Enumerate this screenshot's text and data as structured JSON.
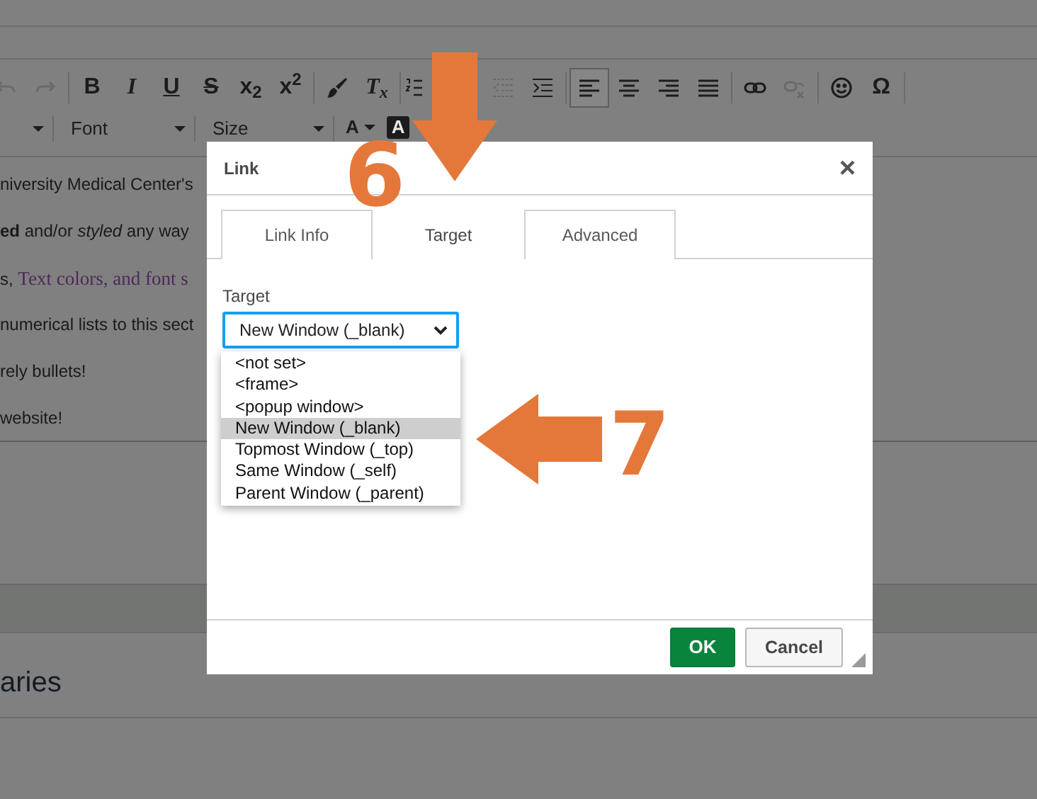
{
  "editor": {
    "toolbar": [
      {
        "kind": "undo",
        "disabled": true,
        "selected": false
      },
      {
        "kind": "redo",
        "disabled": true,
        "selected": false
      },
      {
        "kind": "separator"
      },
      {
        "kind": "bold",
        "label": "B",
        "disabled": false,
        "selected": false
      },
      {
        "kind": "italic",
        "label": "I",
        "disabled": false,
        "selected": false
      },
      {
        "kind": "underline",
        "label": "U",
        "disabled": false,
        "selected": false
      },
      {
        "kind": "strike",
        "label": "S",
        "disabled": false,
        "selected": false
      },
      {
        "kind": "subscript",
        "label": "x$_{2}$",
        "disabled": false,
        "selected": false
      },
      {
        "kind": "superscript",
        "label": "x$^{2}$",
        "disabled": false,
        "selected": false
      },
      {
        "kind": "separator"
      },
      {
        "kind": "brush",
        "disabled": false,
        "selected": false
      },
      {
        "kind": "clear-format",
        "label": "T$_{x}$",
        "disabled": false,
        "selected": false
      },
      {
        "kind": "separator"
      },
      {
        "kind": "numbered-list",
        "disabled": false,
        "selected": false
      },
      {
        "kind": "spacer"
      },
      {
        "kind": "outdent",
        "disabled": true,
        "selected": false
      },
      {
        "kind": "indent",
        "disabled": false,
        "selected": false
      },
      {
        "kind": "separator"
      },
      {
        "kind": "align-left",
        "disabled": false,
        "selected": true
      },
      {
        "kind": "align-center",
        "disabled": false,
        "selected": false
      },
      {
        "kind": "align-right",
        "disabled": false,
        "selected": false
      },
      {
        "kind": "justify",
        "disabled": false,
        "selected": false
      },
      {
        "kind": "separator"
      },
      {
        "kind": "link",
        "disabled": false,
        "selected": false
      },
      {
        "kind": "unlink",
        "disabled": true,
        "selected": false
      },
      {
        "kind": "separator"
      },
      {
        "kind": "smiley",
        "disabled": false,
        "selected": false
      },
      {
        "kind": "symbol",
        "label": "Ω",
        "disabled": false,
        "selected": false
      },
      {
        "kind": "separator"
      }
    ],
    "combos": [
      {
        "label": "Font"
      },
      {
        "label": "Size"
      }
    ],
    "color_buttons": [
      {
        "label": "A",
        "kind": "text-color"
      },
      {
        "label": "A",
        "kind": "background-color"
      }
    ],
    "lines": [
      {
        "text": "niversity Medical Center's"
      },
      {
        "text": "**ed** and/or *styled* any way"
      },
      {
        "text": "s, "
      },
      {
        "text": "numerical lists to this sect"
      },
      {
        "text": "rely bullets!"
      },
      {
        "text": "website!"
      }
    ],
    "colored_text": "Text colors, and font s",
    "heading": "aries"
  },
  "dialog": {
    "title": "Link",
    "close": "×",
    "tabs": [
      {
        "label": "Link Info",
        "selected": false
      },
      {
        "label": "Target",
        "selected": true
      },
      {
        "label": "Advanced",
        "selected": false
      }
    ],
    "field_label": "Target",
    "select_value": "New Window (_blank)",
    "focused": true,
    "options": [
      {
        "label": "<not set>",
        "selected": false
      },
      {
        "label": "<frame>",
        "selected": false
      },
      {
        "label": "<popup window>",
        "selected": false
      },
      {
        "label": "New Window (_blank)",
        "selected": true
      },
      {
        "label": "Topmost Window (_top)",
        "selected": false
      },
      {
        "label": "Same Window (_self)",
        "selected": false
      },
      {
        "label": "Parent Window (_parent)",
        "selected": false
      }
    ],
    "buttons": [
      {
        "label": "OK",
        "kind": "primary"
      },
      {
        "label": "Cancel",
        "kind": "secondary"
      }
    ]
  },
  "annotations": [
    {
      "label": "6",
      "kind": "down"
    },
    {
      "label": "7",
      "kind": "left"
    }
  ]
}
